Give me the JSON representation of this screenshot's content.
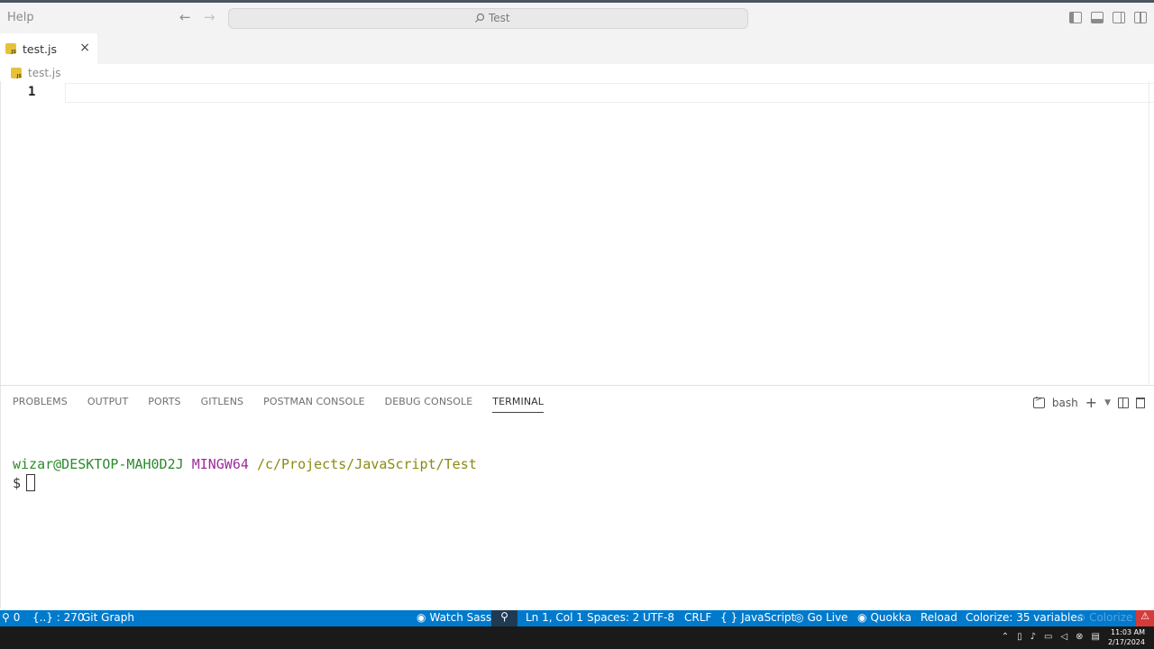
{
  "titlebar": {
    "menu_help": "Help",
    "back_icon": "arrow-left-icon",
    "forward_icon": "arrow-right-icon",
    "search_text": "Test"
  },
  "tab": {
    "label": "test.js",
    "close": "×"
  },
  "breadcrumb": {
    "file": "test.js"
  },
  "editor": {
    "line_number": "1"
  },
  "panel": {
    "tabs": [
      "PROBLEMS",
      "OUTPUT",
      "PORTS",
      "GITLENS",
      "POSTMAN CONSOLE",
      "DEBUG CONSOLE",
      "TERMINAL"
    ],
    "active_tab": "TERMINAL",
    "shell": "bash"
  },
  "terminal": {
    "user": "wizar@DESKTOP-MAH0D2J",
    "system": "MINGW64",
    "path": "/c/Projects/JavaScript/Test",
    "prompt": "$"
  },
  "statusbar": {
    "remote_count": "0",
    "braces": "{..} : 270",
    "git_graph": "Git Graph",
    "watch_sass": "Watch Sass",
    "position": "Ln 1, Col 1",
    "spaces": "Spaces: 2",
    "encoding": "UTF-8",
    "eol": "CRLF",
    "language_braces": "{ }",
    "language": "JavaScript",
    "go_live": "Go Live",
    "quokka": "Quokka",
    "reload": "Reload",
    "colorize": "Colorize: 35 variables",
    "colorize_btn": "Colorize"
  },
  "taskbar": {
    "time": "11:03 AM",
    "date": "2/17/2024"
  },
  "colors": {
    "statusbar_bg": "#007acc",
    "terminal_user": "#2c8a2c",
    "terminal_system": "#9c2c9c",
    "terminal_path": "#8a8a10"
  }
}
